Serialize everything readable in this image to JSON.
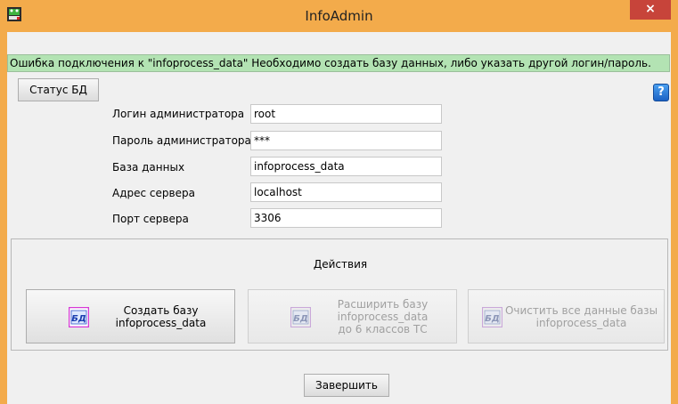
{
  "window": {
    "title": "InfoAdmin",
    "close_label": "×",
    "app_icon": "frog-db-icon"
  },
  "status_message": "Ошибка подключения к \"infoprocess_data\" Необходимо создать базу данных, либо указать другой логин/пароль.",
  "buttons": {
    "db_status": "Статус БД",
    "help": "?",
    "finish": "Завершить"
  },
  "form": {
    "admin_login_label": "Логин администратора",
    "admin_login_value": "root",
    "admin_password_label": "Пароль администратора",
    "admin_password_value": "***",
    "database_label": "База данных",
    "database_value": "infoprocess_data",
    "server_address_label": "Адрес сервера",
    "server_address_value": "localhost",
    "server_port_label": "Порт сервера",
    "server_port_value": "3306"
  },
  "actions": {
    "title": "Действия",
    "icon_text": "БД",
    "create_label": "Создать базу\ninfoprocess_data",
    "extend_label": "Расширить базу\ninfoprocess_data\nдо 6 классов ТС",
    "clear_label": "Очистить все данные базы\ninfoprocess_data"
  },
  "colors": {
    "titlebar": "#f3ab4b",
    "close": "#c7443a",
    "status_bg": "#b3e3b3",
    "help": "#1b62c4"
  }
}
